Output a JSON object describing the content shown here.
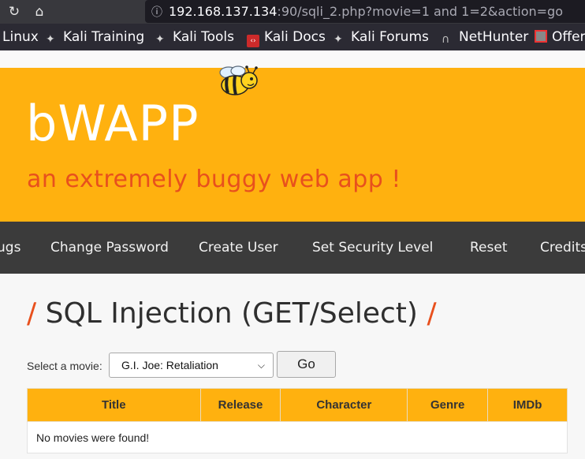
{
  "browser": {
    "url_host": "192.168.137.134",
    "url_rest": ":90/sqli_2.php?movie=1 and 1=2&action=go"
  },
  "bookmarks": [
    {
      "label": "Linux"
    },
    {
      "label": "Kali Training"
    },
    {
      "label": "Kali Tools"
    },
    {
      "label": "Kali Docs"
    },
    {
      "label": "Kali Forums"
    },
    {
      "label": "NetHunter"
    },
    {
      "label": "Offer"
    }
  ],
  "header": {
    "logo": "bWAPP",
    "tagline": "an extremely buggy web app !"
  },
  "nav": {
    "items": [
      "ugs",
      "Change Password",
      "Create User",
      "Set Security Level",
      "Reset",
      "Credits"
    ]
  },
  "main": {
    "title": "SQL Injection (GET/Select)",
    "slash": "/",
    "select_label": "Select a movie:",
    "selected_movie": "G.I. Joe: Retaliation",
    "go_label": "Go"
  },
  "table": {
    "headers": [
      "Title",
      "Release",
      "Character",
      "Genre",
      "IMDb"
    ],
    "empty_message": "No movies were found!"
  },
  "colors": {
    "accent": "#ffb10f",
    "tagline": "#e8501d",
    "nav_bg": "#3b3b3b"
  }
}
